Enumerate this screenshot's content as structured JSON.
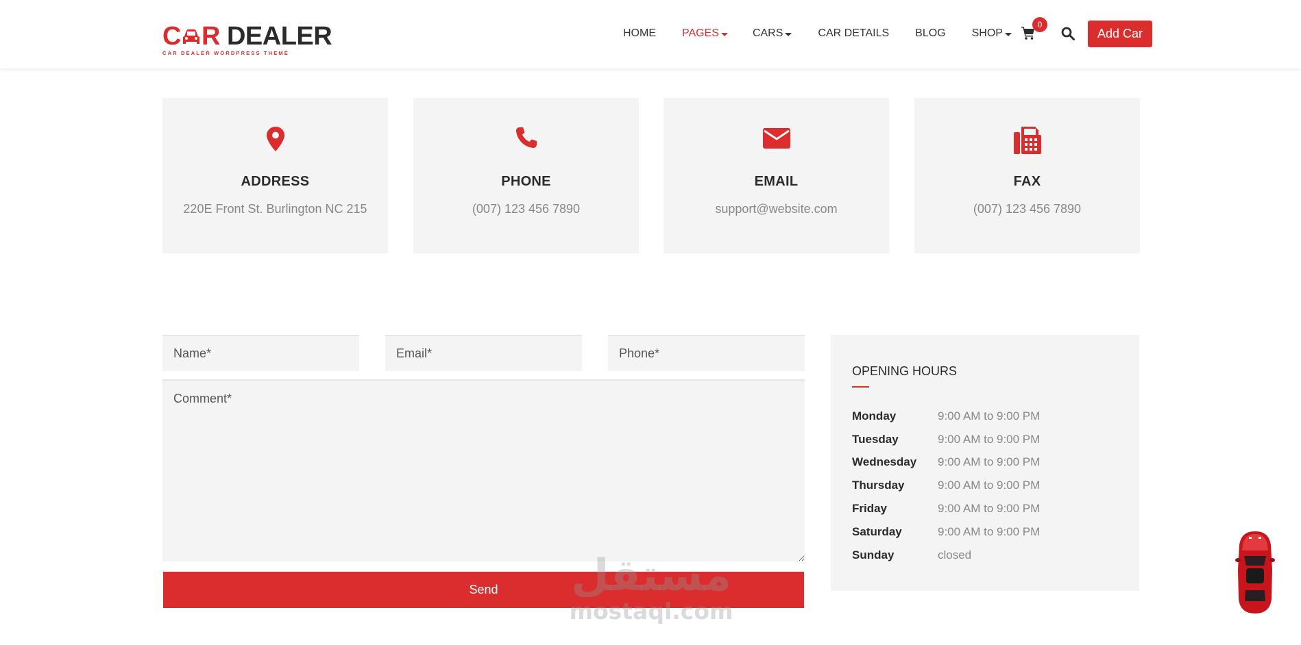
{
  "header": {
    "logo_text_a": "C",
    "logo_text_r": "R",
    "logo_text_dealer": "DEALER",
    "logo_tagline": "CAR DEALER WORDPRESS THEME",
    "nav": [
      {
        "label": "HOME",
        "dropdown": false,
        "active": false
      },
      {
        "label": "PAGES",
        "dropdown": true,
        "active": true
      },
      {
        "label": "CARS",
        "dropdown": true,
        "active": false
      },
      {
        "label": "CAR DETAILS",
        "dropdown": false,
        "active": false
      },
      {
        "label": "BLOG",
        "dropdown": false,
        "active": false
      },
      {
        "label": "SHOP",
        "dropdown": true,
        "active": false
      }
    ],
    "cart_count": "0",
    "cta_label": "Add Car"
  },
  "contact_cards": [
    {
      "icon": "map-marker-icon",
      "title": "ADDRESS",
      "value": "220E Front St. Burlington NC 215"
    },
    {
      "icon": "phone-icon",
      "title": "PHONE",
      "value": "(007) 123 456 7890"
    },
    {
      "icon": "envelope-icon",
      "title": "EMAIL",
      "value": "support@website.com"
    },
    {
      "icon": "fax-icon",
      "title": "FAX",
      "value": "(007) 123 456 7890"
    }
  ],
  "form": {
    "name_placeholder": "Name*",
    "email_placeholder": "Email*",
    "phone_placeholder": "Phone*",
    "comment_placeholder": "Comment*",
    "submit_label": "Send"
  },
  "opening_hours": {
    "title": "OPENING HOURS",
    "rows": [
      {
        "day": "Monday",
        "time": "9:00 AM to 9:00 PM"
      },
      {
        "day": "Tuesday",
        "time": "9:00 AM to 9:00 PM"
      },
      {
        "day": "Wednesday",
        "time": "9:00 AM to 9:00 PM"
      },
      {
        "day": "Thursday",
        "time": "9:00 AM to 9:00 PM"
      },
      {
        "day": "Friday",
        "time": "9:00 AM to 9:00 PM"
      },
      {
        "day": "Saturday",
        "time": "9:00 AM to 9:00 PM"
      },
      {
        "day": "Sunday",
        "time": "closed"
      }
    ]
  },
  "watermark": {
    "arabic": "مستقل",
    "latin": "mostaql.com"
  },
  "colors": {
    "accent": "#db2d2e",
    "card_bg": "#f4f4f4",
    "text_dark": "#2b2b2b",
    "text_muted": "#888888"
  }
}
